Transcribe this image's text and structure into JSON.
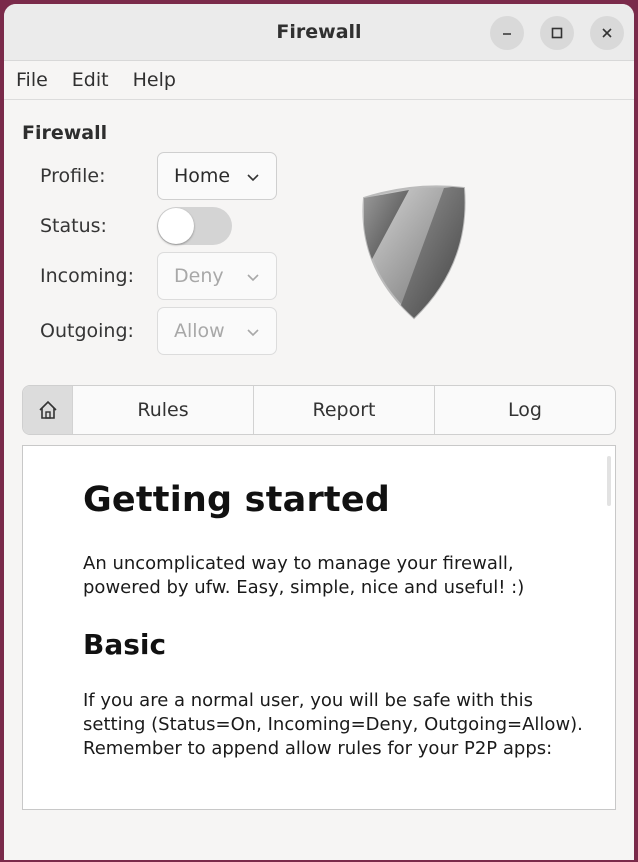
{
  "window": {
    "title": "Firewall"
  },
  "menu": {
    "items": [
      "File",
      "Edit",
      "Help"
    ]
  },
  "firewall": {
    "section_title": "Firewall",
    "profile": {
      "label": "Profile:",
      "value": "Home"
    },
    "status": {
      "label": "Status:",
      "on": false
    },
    "incoming": {
      "label": "Incoming:",
      "value": "Deny"
    },
    "outgoing": {
      "label": "Outgoing:",
      "value": "Allow"
    }
  },
  "tabs": {
    "home_icon": "home-icon",
    "items": [
      "Rules",
      "Report",
      "Log"
    ]
  },
  "doc": {
    "heading": "Getting started",
    "intro": "An uncomplicated way to manage your firewall, powered by ufw. Easy, simple, nice and useful! :)",
    "basic_heading": "Basic",
    "basic_text": "If you are a normal user, you will be safe with this setting (Status=On, Incoming=Deny, Outgoing=Allow). Remember to append allow rules for your P2P apps:"
  }
}
